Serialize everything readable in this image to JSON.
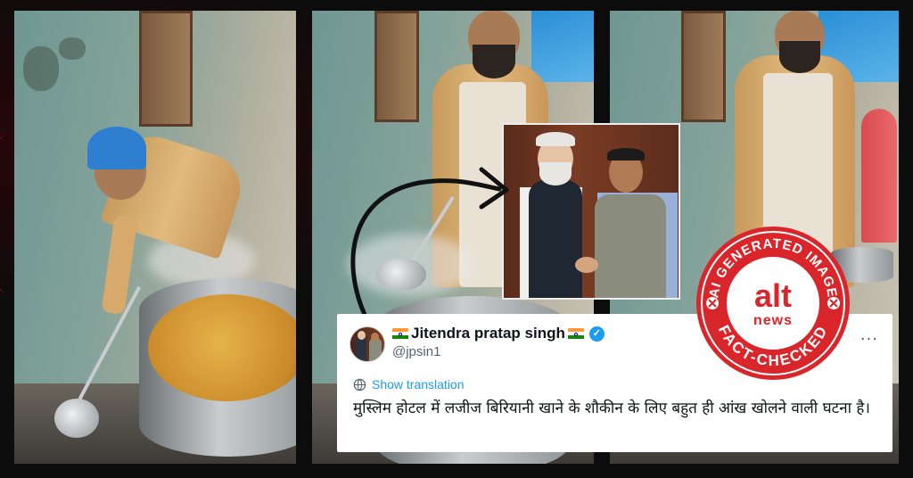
{
  "tweet": {
    "display_name": "Jitendra pratap singh",
    "handle": "@jpsin1",
    "show_translation": "Show translation",
    "text": "मुस्लिम होटल में लजीज बिरियानी खाने के शौकीन के लिए बहुत ही आंख खोलने वाली घटना है।"
  },
  "badge": {
    "top_text": "AI GENERATED IMAGE",
    "logo_top": "alt",
    "logo_bottom": "news",
    "bottom_text": "FACT-CHECKED",
    "color": "#d9262b"
  },
  "colors": {
    "verified": "#1d9bf0",
    "link": "#1d9bf0",
    "background": "#0c0c0d"
  }
}
